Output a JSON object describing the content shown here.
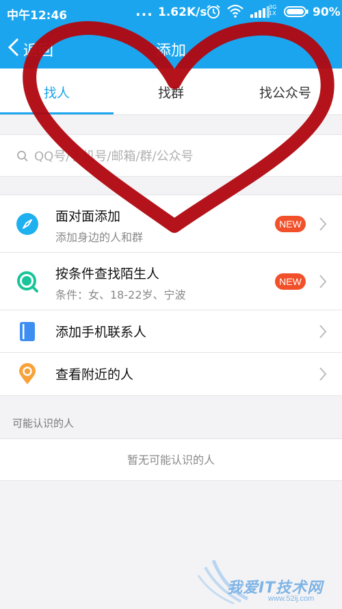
{
  "status_bar": {
    "time": "中午12:46",
    "dots": "...",
    "net_speed": "1.62K/s",
    "network_type": "3G",
    "network_sub": "1X",
    "battery": "90%"
  },
  "header": {
    "back_label": "返回",
    "title": "添加"
  },
  "tabs": [
    {
      "label": "找人",
      "active": true
    },
    {
      "label": "找群",
      "active": false
    },
    {
      "label": "找公众号",
      "active": false
    }
  ],
  "search": {
    "placeholder": "QQ号/手机号/邮箱/群/公众号"
  },
  "list": {
    "items": [
      {
        "title": "面对面添加",
        "subtitle": "添加身边的人和群",
        "badge": "NEW",
        "icon": "compass-icon",
        "color": "#1fb0f0"
      },
      {
        "title": "按条件查找陌生人",
        "subtitle": "条件：女、18-22岁、宁波",
        "badge": "NEW",
        "icon": "magnifier-icon",
        "color": "#19c49a"
      },
      {
        "title": "添加手机联系人",
        "icon": "contacts-book-icon",
        "color": "#3d8ef0"
      },
      {
        "title": "查看附近的人",
        "icon": "location-pin-icon",
        "color": "#f8a23a"
      }
    ]
  },
  "maybe_known": {
    "label": "可能认识的人",
    "empty": "暂无可能认识的人"
  },
  "watermark": {
    "text": "我爱IT技术网",
    "url": "www.52ij.com"
  },
  "colors": {
    "accent": "#1aa5ee",
    "badge": "#f2502a",
    "heart": "#b0060f"
  }
}
